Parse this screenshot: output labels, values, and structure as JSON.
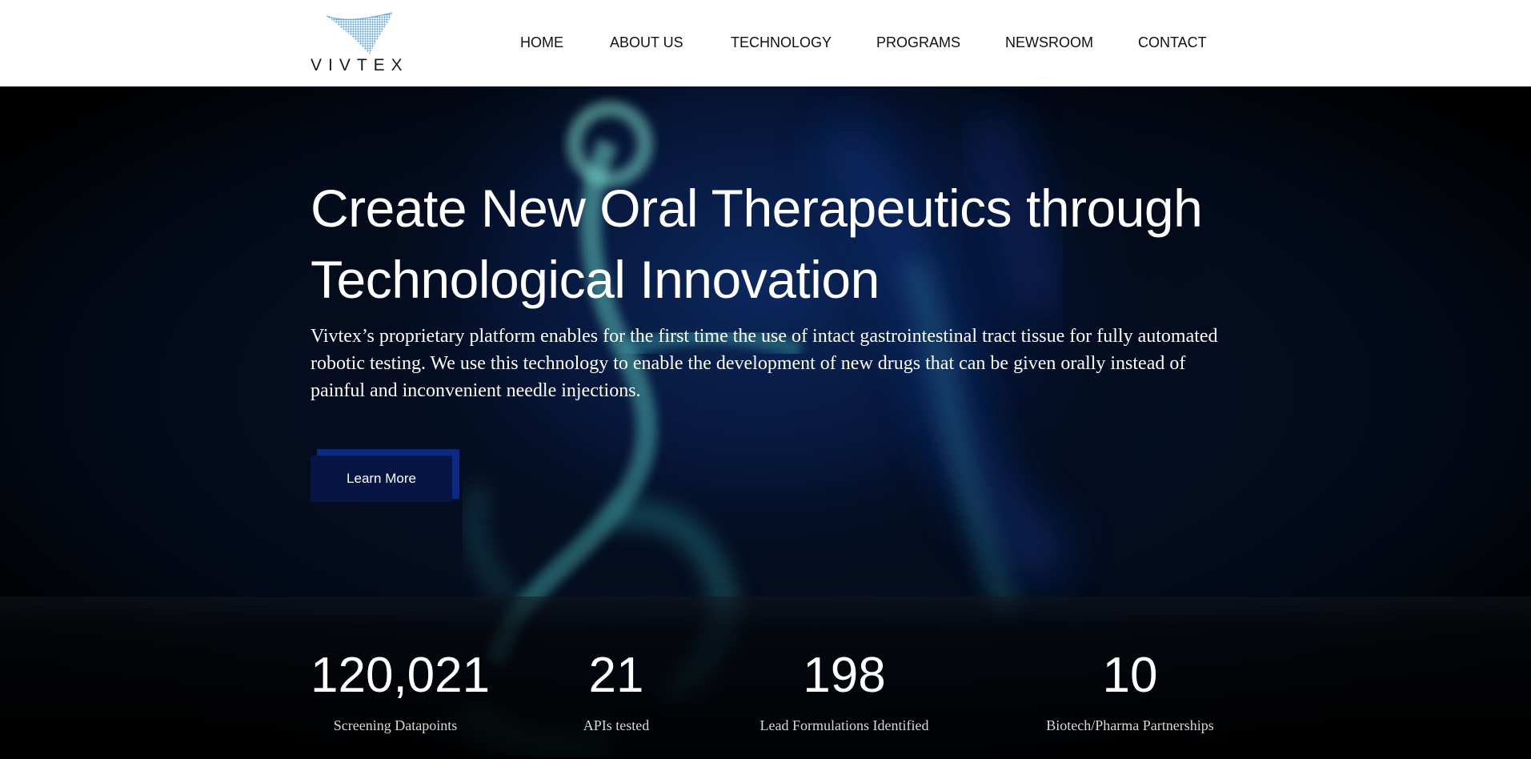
{
  "brand": {
    "name": "VIVTEX"
  },
  "nav": {
    "items": [
      {
        "label": "HOME"
      },
      {
        "label": "ABOUT US"
      },
      {
        "label": "TECHNOLOGY"
      },
      {
        "label": "PROGRAMS"
      },
      {
        "label": "NEWSROOM"
      },
      {
        "label": "CONTACT"
      }
    ]
  },
  "hero": {
    "title_line1": "Create New Oral Therapeutics through",
    "title_line2": "Technological Innovation",
    "description": "Vivtex’s proprietary platform enables for the first time the use of intact gastrointestinal tract tissue for fully automated robotic testing. We use this technology to enable the development of new drugs that can be given orally instead of painful and inconvenient needle injections.",
    "cta_label": "Learn More"
  },
  "stats": [
    {
      "value": "120,021",
      "label": "Screening Datapoints"
    },
    {
      "value": "21",
      "label": "APIs tested"
    },
    {
      "value": "198",
      "label": "Lead Formulations Identified"
    },
    {
      "value": "10",
      "label": "Biotech/Pharma Partnerships"
    }
  ],
  "colors": {
    "header_bg": "#ffffff",
    "hero_bg": "#010307",
    "cta_bg": "#061544",
    "cta_accent": "#0b2a86",
    "text_light": "#ffffff"
  }
}
